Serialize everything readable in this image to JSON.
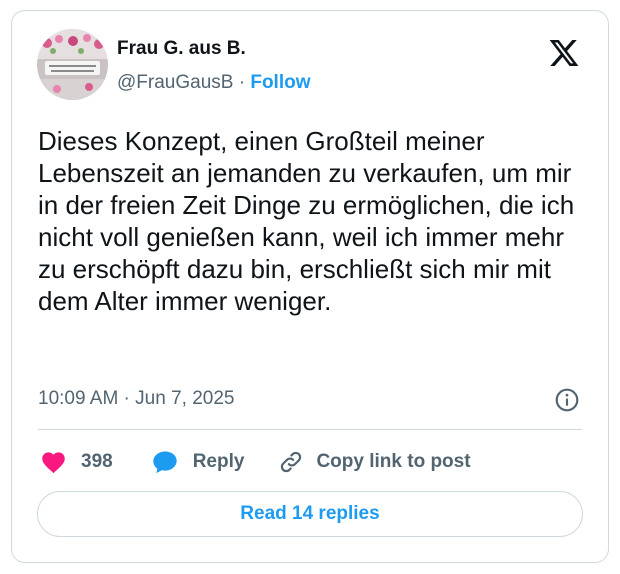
{
  "author": {
    "display_name": "Frau G. aus B.",
    "handle": "@FrauGausB",
    "separator": "·",
    "follow_label": "Follow"
  },
  "tweet": {
    "text": "Dieses Konzept, einen Großteil meiner Lebenszeit an jemanden zu verkaufen, um mir in der freien Zeit Dinge zu ermöglichen, die ich nicht voll genießen kann, weil ich immer mehr zu erschöpft dazu bin, erschließt sich mir mit dem Alter immer weniger.",
    "timestamp": "10:09 AM · Jun 7, 2025"
  },
  "actions": {
    "like_count": "398",
    "reply_label": "Reply",
    "copy_link_label": "Copy link to post"
  },
  "footer": {
    "read_replies_label": "Read 14 replies"
  },
  "icons": {
    "logo": "x-logo-icon",
    "info": "info-icon",
    "like": "heart-icon",
    "reply": "speech-bubble-icon",
    "copy_link": "link-icon"
  },
  "colors": {
    "accent": "#1d9bf0",
    "like": "#f91880",
    "text": "#0f1419",
    "secondary": "#536471",
    "border": "#cfd9de"
  }
}
